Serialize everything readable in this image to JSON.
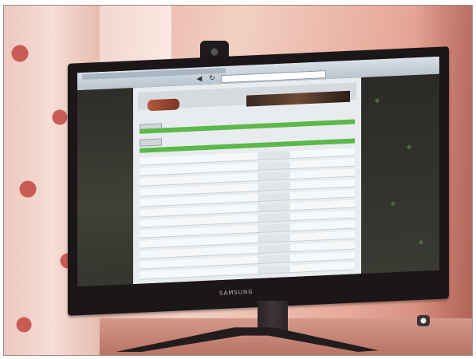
{
  "photo": {
    "monitor_brand": "SAMSUNG",
    "colors": {
      "wall": "#e8b0a0",
      "bezel": "#1b1618",
      "forum_green": "#5db84b",
      "page_bg": "#e9ecef"
    }
  }
}
